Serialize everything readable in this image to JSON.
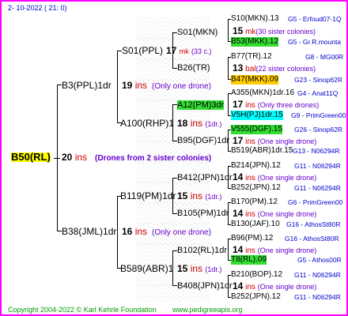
{
  "date": "2- 10-2022 ( 21: 0)",
  "root": {
    "label": "B50(RL)",
    "ins_num": "20",
    "ins": "ins",
    "note": "(Drones from 2 sister colonies)"
  },
  "g1": [
    {
      "label": "B3(PPL)1dr",
      "ins_num": "19",
      "ins": "ins",
      "note": "(Only one drone)"
    },
    {
      "label": "B38(JML)1dr",
      "ins_num": "16",
      "ins": "ins",
      "note": "(Only one drone)"
    }
  ],
  "g2": [
    {
      "label": "S01(PPL)",
      "ins_num": "17",
      "ins": "mk",
      "note": "(33 c.)"
    },
    {
      "label": "A100(RHP)1",
      "ins_num": "18",
      "ins": "ins",
      "note": "(1dr.)"
    },
    {
      "label": "B119(PM)1dr",
      "ins_num": "15",
      "ins": "ins",
      "note": "(1dr.)"
    },
    {
      "label": "B589(ABR)1",
      "ins_num": "15",
      "ins": "ins",
      "note": "(1dr.)"
    }
  ],
  "g3": [
    {
      "label": "S01(MKN)",
      "ins_num": "15",
      "ins": "mk",
      "note": "(30 sister colonies)"
    },
    {
      "label": "B26(TR)",
      "ins_num": "13",
      "ins": "bal",
      "note": "(22 sister colonies)"
    },
    {
      "label": "A12(PM)3dr",
      "ins_num": "17",
      "ins": "ins",
      "note": "(Only three drones)"
    },
    {
      "label": "B95(DGF)1dr",
      "ins_num": "17",
      "ins": "ins",
      "note": "(One single drone)"
    },
    {
      "label": "B412(JPN)1dr",
      "ins_num": "14",
      "ins": "ins",
      "note": "(One single drone)"
    },
    {
      "label": "B105(PM)1dr",
      "ins_num": "14",
      "ins": "ins",
      "note": "(One single drone)"
    },
    {
      "label": "B102(RL)1dr",
      "ins_num": "14",
      "ins": "ins",
      "note": "(One single drone)"
    },
    {
      "label": "B408(JPN)1dr",
      "ins_num": "14",
      "ins": "ins",
      "note": "(One single drone)"
    }
  ],
  "g4": [
    {
      "label": "S10(MKN).13",
      "info": "G5 - Erfoud07-1Q"
    },
    {
      "label": "B53(MKK).12",
      "info": "G5 - Gr.R.mounta"
    },
    {
      "label": "B77(TR).12",
      "info": "G8 - MG00R"
    },
    {
      "label": "B47(MKK).09",
      "info": "G23 - Sinop62R"
    },
    {
      "label": "A355(MKN)1dr.16",
      "info": "G4 - Anat11Q"
    },
    {
      "label": "V5H(PJ)1dr.15",
      "info": "G9 - PrimGreen00"
    },
    {
      "label": "V555(DGF).15",
      "info": "G26 - Sinop62R"
    },
    {
      "label": "B519(ABR)1dr.15",
      "info": "G13 - N06294R"
    },
    {
      "label": "B214(JPN).12",
      "info": "G11 - N06294R"
    },
    {
      "label": "B252(JPN).12",
      "info": "G11 - N06294R"
    },
    {
      "label": "B170(PM).12",
      "info": "G6 - PrimGreen00"
    },
    {
      "label": "B130(JAF).10",
      "info": "G16 - AthosSt80R"
    },
    {
      "label": "B96(PM).12",
      "info": "G16 - AthosSt80R"
    },
    {
      "label": "T8(RL).09",
      "info": "G5 - Athos00R"
    },
    {
      "label": "B210(BOP).12",
      "info": "G11 - N06294R"
    },
    {
      "label": "B252(JPN).12",
      "info": "G11 - N06294R"
    }
  ],
  "copyright": "Copyright 2004-2022 © Karl Kehrle Foundation",
  "website": "www.pedigreeapis.org"
}
